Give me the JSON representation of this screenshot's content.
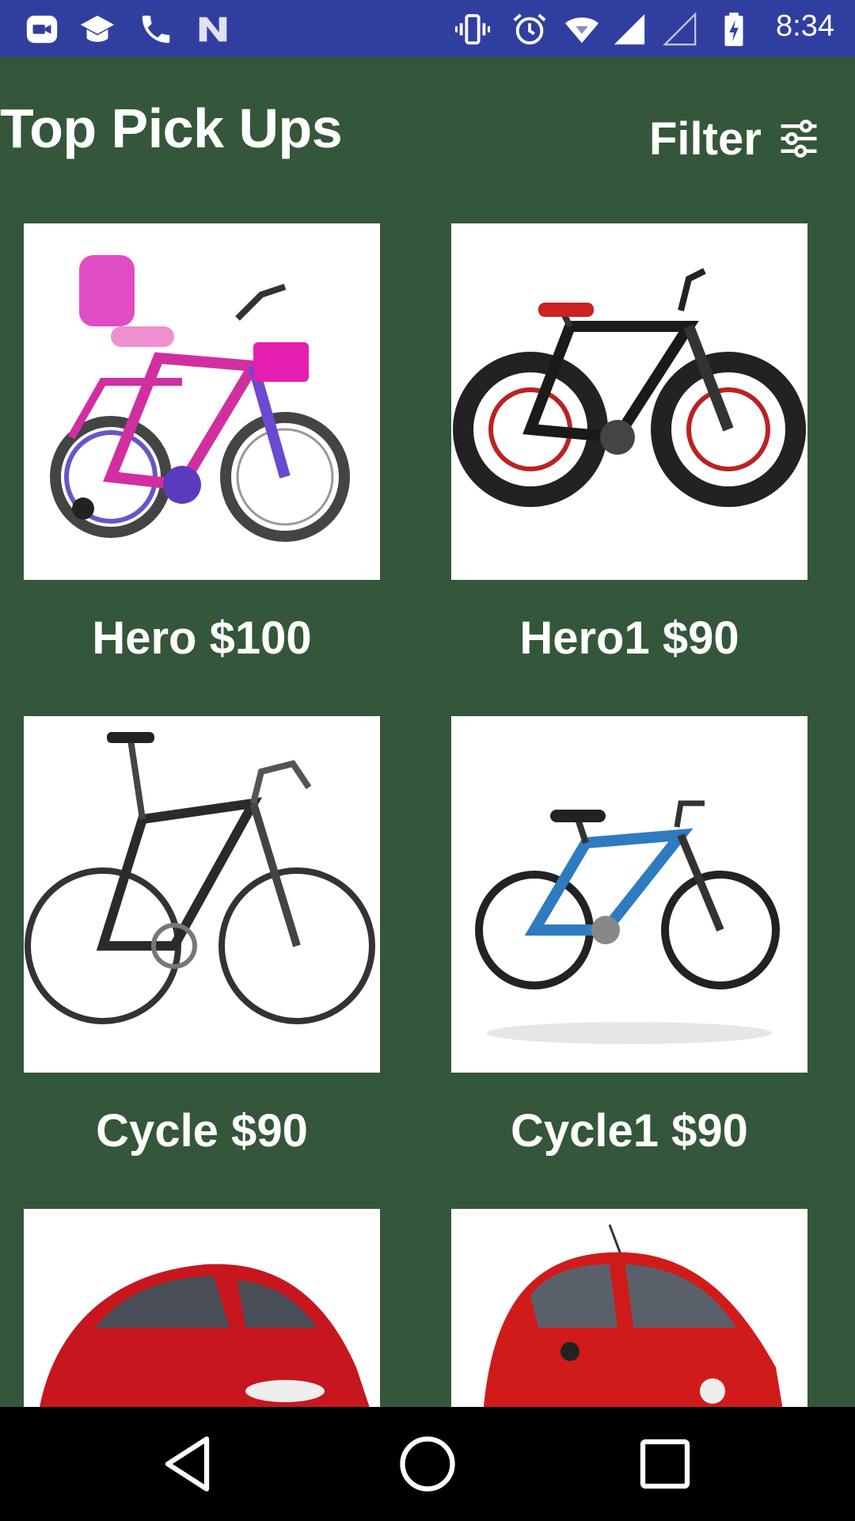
{
  "status_bar": {
    "time": "8:34",
    "icons": [
      "video-call-icon",
      "school-icon",
      "phone-icon",
      "n-logo-icon",
      "vibrate-icon",
      "alarm-icon",
      "wifi-icon",
      "signal-icon",
      "signal-empty-icon",
      "battery-charging-icon"
    ]
  },
  "header": {
    "title": "Top Pick Ups",
    "filter_label": "Filter",
    "filter_icon": "tune-sliders-icon"
  },
  "products": [
    {
      "label": "Hero $100",
      "image": "kids-bicycle-pink"
    },
    {
      "label": "Hero1 $90",
      "image": "mountain-bicycle-black"
    },
    {
      "label": "Cycle $90",
      "image": "road-bicycle-grey"
    },
    {
      "label": "Cycle1 $90",
      "image": "bicycle-blue"
    },
    {
      "label": "",
      "image": "car-sedan-red"
    },
    {
      "label": "",
      "image": "car-hatchback-red"
    }
  ],
  "nav_bar": {
    "back": "back-icon",
    "home": "home-icon",
    "recents": "recents-icon"
  },
  "colors": {
    "status_bar": "#303f9f",
    "background": "#34563a",
    "card": "#ffffff",
    "text": "#ffffff",
    "nav_bar": "#000000"
  }
}
